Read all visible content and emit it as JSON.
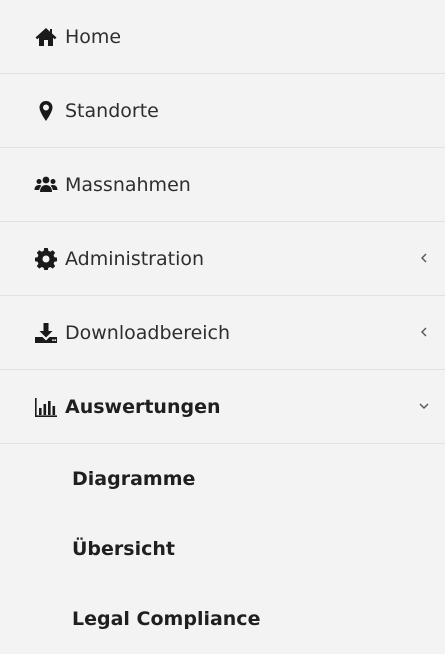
{
  "nav": {
    "items": [
      {
        "label": "Home",
        "icon": "home-icon"
      },
      {
        "label": "Standorte",
        "icon": "map-marker-icon"
      },
      {
        "label": "Massnahmen",
        "icon": "users-icon"
      },
      {
        "label": "Administration",
        "icon": "gear-icon",
        "chevron": "chevron-left-icon"
      },
      {
        "label": "Downloadbereich",
        "icon": "download-icon",
        "chevron": "chevron-left-icon"
      },
      {
        "label": "Auswertungen",
        "icon": "bar-chart-icon",
        "chevron": "chevron-down-icon",
        "active": true
      }
    ],
    "subitems": [
      {
        "label": "Diagramme"
      },
      {
        "label": "Übersicht"
      },
      {
        "label": "Legal Compliance"
      }
    ]
  },
  "colors": {
    "background": "#f3f3f3",
    "divider": "#e1e1e1",
    "text": "#2e2e2e",
    "icon": "#1a1a1a"
  }
}
